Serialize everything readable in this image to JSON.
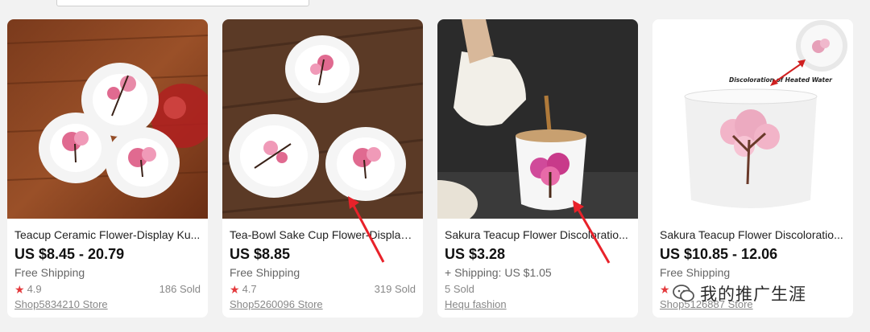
{
  "products": [
    {
      "title": "Teacup Ceramic Flower-Display Ku...",
      "price": "US $8.45 - 20.79",
      "shipping": "Free Shipping",
      "rating": "4.9",
      "sold": "186 Sold",
      "store": "Shop5834210 Store",
      "image_icon": "sakura-plates-photo"
    },
    {
      "title": "Tea-Bowl Sake Cup Flower-Display ...",
      "price": "US $8.85",
      "shipping": "Free Shipping",
      "rating": "4.7",
      "sold": "319 Sold",
      "store": "Shop5260096 Store",
      "image_icon": "sakura-bowls-photo"
    },
    {
      "title": "Sakura Teacup Flower Discoloratio...",
      "price": "US $3.28",
      "shipping": "+ Shipping: US $1.05",
      "rating": "",
      "sold": "5 Sold",
      "store": "Hequ fashion",
      "image_icon": "pouring-tea-photo"
    },
    {
      "title": "Sakura Teacup Flower Discoloratio...",
      "price": "US $10.85 - 12.06",
      "shipping": "Free Shipping",
      "rating": "",
      "sold": "",
      "store": "Shop5126887 Store",
      "image_caption": "Discoloration of Heated Water",
      "image_icon": "sakura-cup-photo"
    }
  ],
  "watermark": "我的推广生涯",
  "colors": {
    "star": "#e4393c",
    "arrow": "#e8222a",
    "background": "#f2f2f2"
  }
}
